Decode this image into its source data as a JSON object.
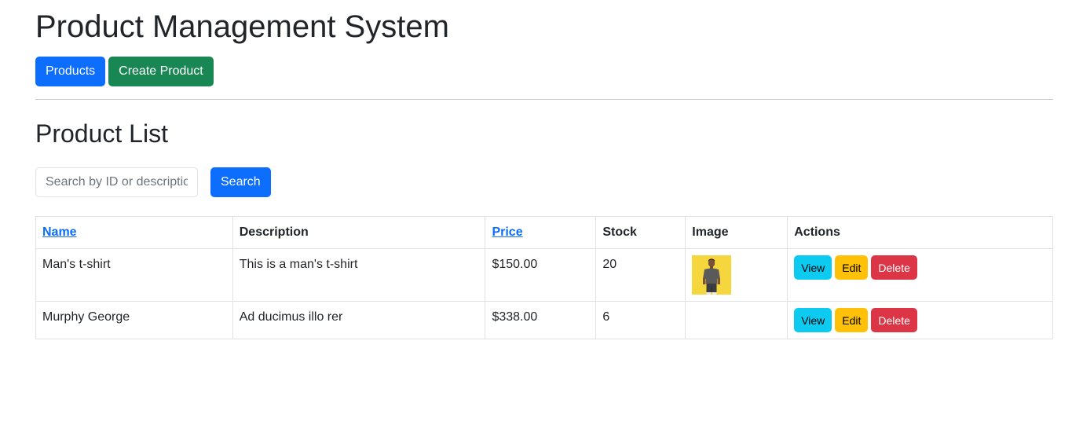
{
  "header": {
    "title": "Product Management System"
  },
  "nav": {
    "products_label": "Products",
    "create_label": "Create Product"
  },
  "section": {
    "title": "Product List"
  },
  "search": {
    "placeholder": "Search by ID or description",
    "value": "",
    "button_label": "Search"
  },
  "table": {
    "headers": {
      "name": "Name",
      "description": "Description",
      "price": "Price",
      "stock": "Stock",
      "image": "Image",
      "actions": "Actions"
    },
    "rows": [
      {
        "name": "Man's t-shirt",
        "description": "This is a man's t-shirt",
        "price": "$150.00",
        "stock": "20",
        "has_image": true,
        "image_icon": "product-photo-man-in-tshirt"
      },
      {
        "name": "Murphy George",
        "description": "Ad ducimus illo rer",
        "price": "$338.00",
        "stock": "6",
        "has_image": false
      }
    ],
    "action_labels": {
      "view": "View",
      "edit": "Edit",
      "delete": "Delete"
    }
  },
  "colors": {
    "primary": "#0d6efd",
    "success": "#198754",
    "info": "#0dcaf0",
    "warning": "#ffc107",
    "danger": "#dc3545"
  }
}
